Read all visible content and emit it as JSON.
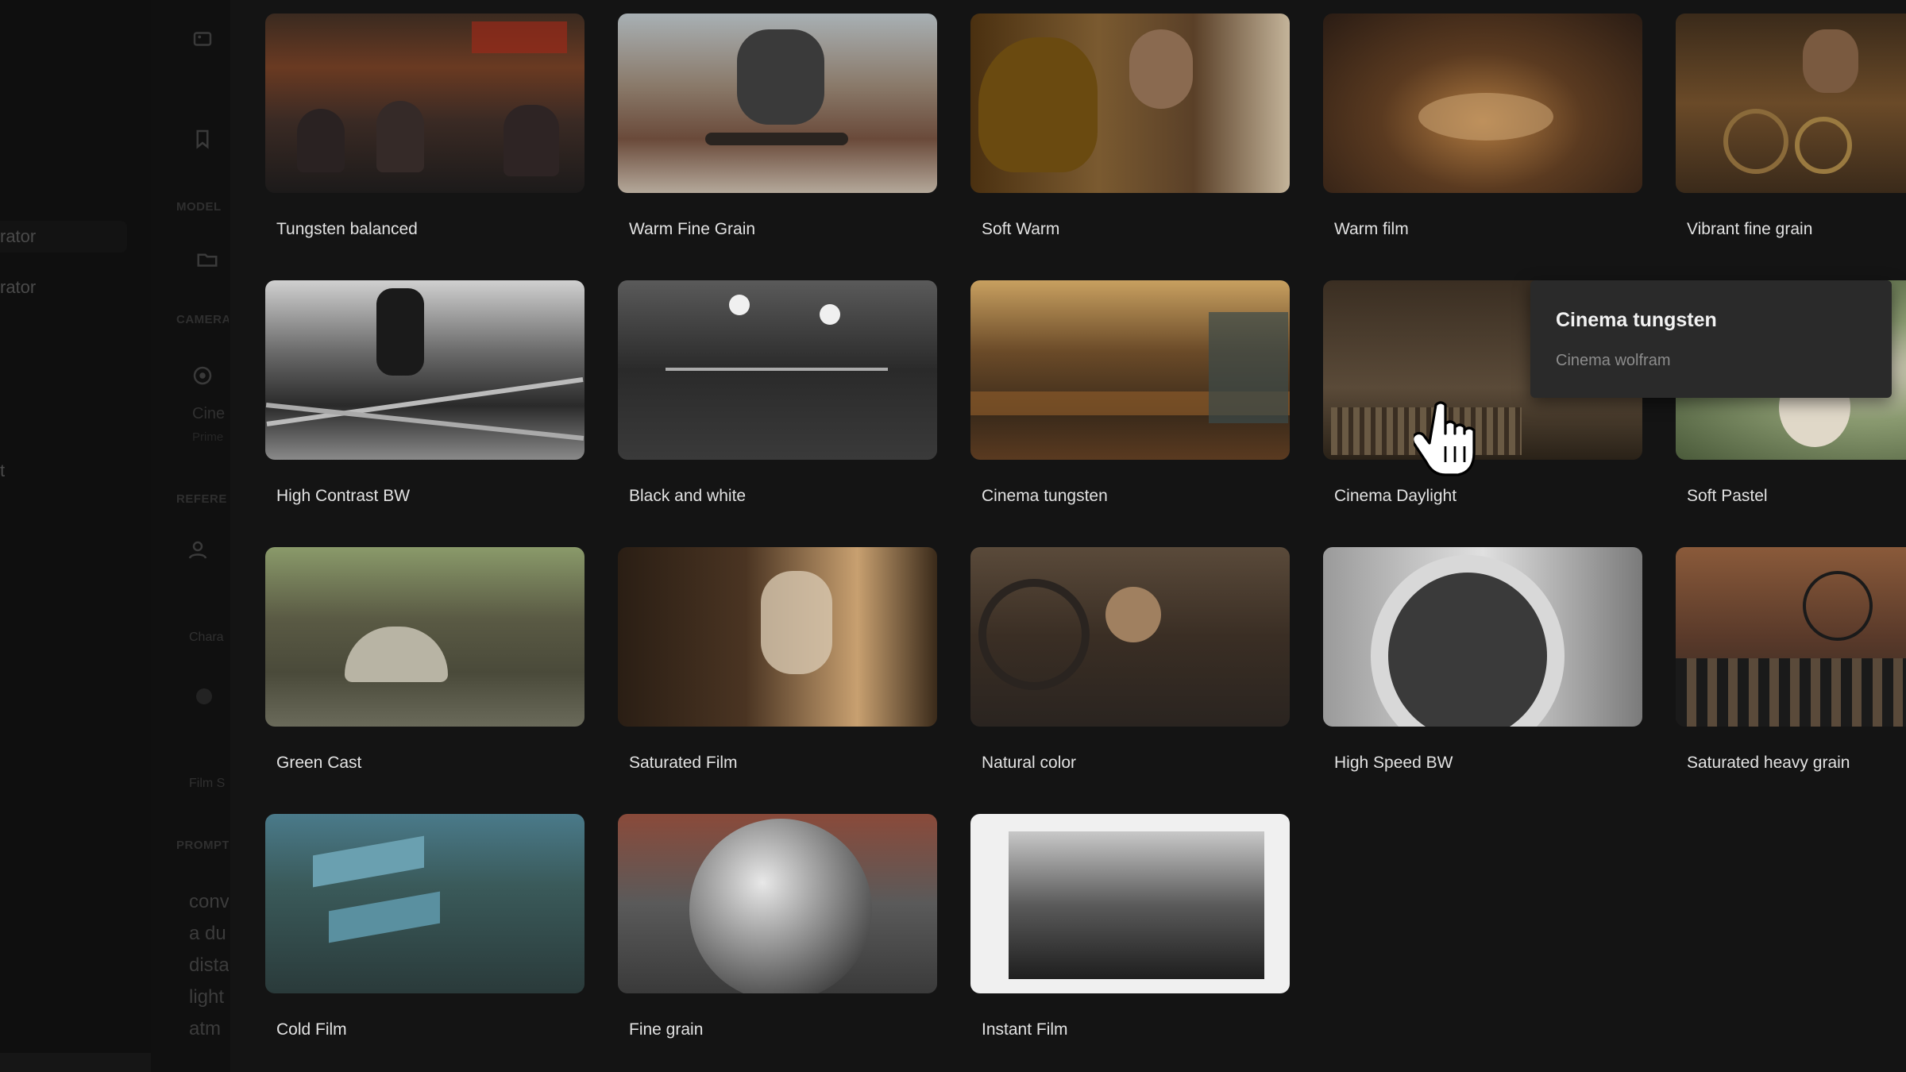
{
  "sidebar": {
    "items": [
      {
        "label": "rator"
      },
      {
        "label": "rator"
      },
      {
        "label": "t"
      }
    ]
  },
  "settings": {
    "sections": {
      "model": "MODEL",
      "camera": "CAMERA",
      "reference": "REFERE",
      "prompt": "PROMPT"
    },
    "camera_name": "Cine",
    "camera_sub": "Prime",
    "character_label": "Chara",
    "film_stock_label": "Film S",
    "prompt_lines": [
      "conv",
      "a du",
      "dista",
      "light",
      "atm"
    ]
  },
  "presets": [
    {
      "label": "Tungsten balanced",
      "icon": "city-crowd-image"
    },
    {
      "label": "Warm Fine Grain",
      "icon": "skater-image"
    },
    {
      "label": "Soft Warm",
      "icon": "kettle-image"
    },
    {
      "label": "Warm film",
      "icon": "dining-room-image"
    },
    {
      "label": "Vibrant fine grain",
      "icon": "watchmaker-image"
    },
    {
      "label": "High Contrast BW",
      "icon": "bw-street-image"
    },
    {
      "label": "Black and white",
      "icon": "bw-interior-image"
    },
    {
      "label": "Cinema tungsten",
      "icon": "diner-image"
    },
    {
      "label": "Cinema Daylight",
      "icon": "library-image"
    },
    {
      "label": "Soft Pastel",
      "icon": "forest-image"
    },
    {
      "label": "Green Cast",
      "icon": "umbrella-street-image"
    },
    {
      "label": "Saturated Film",
      "icon": "glass-image"
    },
    {
      "label": "Natural color",
      "icon": "mechanic-image"
    },
    {
      "label": "High Speed BW",
      "icon": "cup-image"
    },
    {
      "label": "Saturated heavy grain",
      "icon": "bicycle-image"
    },
    {
      "label": "Cold Film",
      "icon": "market-street-image"
    },
    {
      "label": "Fine grain",
      "icon": "chrome-sphere-image"
    },
    {
      "label": "Instant Film",
      "icon": "polaroid-image"
    }
  ],
  "tooltip": {
    "title": "Cinema tungsten",
    "subtitle": "Cinema wolfram"
  },
  "colors": {
    "background": "#141414",
    "tooltip_bg": "#2a2a2a",
    "label": "#e2e2e2"
  }
}
